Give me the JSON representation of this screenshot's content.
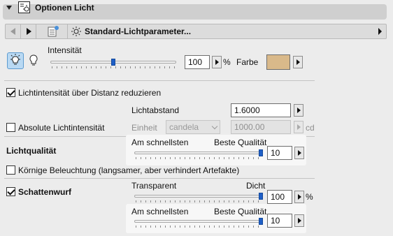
{
  "header": {
    "title": "Optionen Licht",
    "icon": "light-settings-icon"
  },
  "navbar": {
    "preset": "Standard-Lichtparameter..."
  },
  "intensity": {
    "label": "Intensität",
    "value": "100",
    "unit": "%",
    "slider_fraction": 0.5
  },
  "color": {
    "label": "Farbe",
    "swatch": "#d9b98a"
  },
  "distance_reduce": {
    "label": "Lichtintensität über Distanz reduzieren",
    "checked": true
  },
  "light_distance": {
    "label": "Lichtabstand",
    "value": "1.6000"
  },
  "absolute_intensity": {
    "label": "Absolute Lichtintensität",
    "checked": false
  },
  "unit": {
    "label": "Einheit",
    "value": "candela",
    "amount": "1000.00",
    "suffix": "cd"
  },
  "quality": {
    "label": "Lichtqualität",
    "min_label": "Am schnellsten",
    "max_label": "Beste Qualität",
    "value": "10",
    "slider_fraction": 1.0
  },
  "grainy": {
    "label": "Körnige Beleuchtung (langsamer, aber verhindert Artefakte)",
    "checked": false
  },
  "shadow": {
    "label": "Schattenwurf",
    "checked": true,
    "transparency": {
      "min_label": "Transparent",
      "max_label": "Dicht",
      "value": "100",
      "unit": "%",
      "slider_fraction": 1.0
    },
    "quality": {
      "min_label": "Am schnellsten",
      "max_label": "Beste Qualität",
      "value": "10",
      "slider_fraction": 1.0
    }
  },
  "colors": {
    "accent": "#1f5fc7",
    "header_bg": "#cfcfcf",
    "active_toggle": "#b9d9f3"
  }
}
